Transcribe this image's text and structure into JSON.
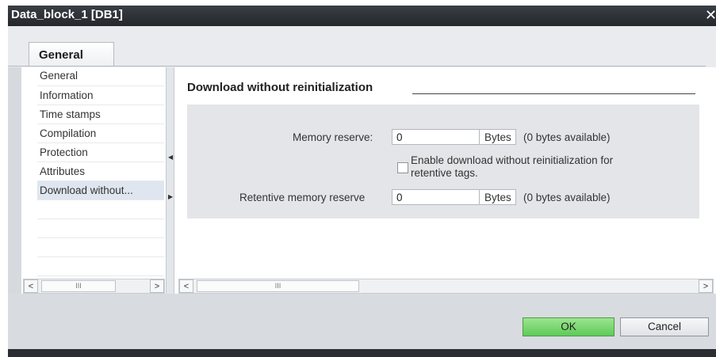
{
  "window": {
    "title": "Data_block_1 [DB1]",
    "close_glyph": "✕"
  },
  "tabs": [
    {
      "label": "General",
      "selected": true
    }
  ],
  "sidebar": {
    "items": [
      {
        "label": "General"
      },
      {
        "label": "Information"
      },
      {
        "label": "Time stamps"
      },
      {
        "label": "Compilation"
      },
      {
        "label": "Protection"
      },
      {
        "label": "Attributes"
      },
      {
        "label": "Download without...",
        "selected": true
      }
    ]
  },
  "scrollbar": {
    "left_arrow": "<",
    "right_arrow": ">",
    "thumb_grip": "III"
  },
  "section": {
    "title": "Download without reinitialization",
    "memory_reserve": {
      "label": "Memory reserve:",
      "value": "0",
      "unit": "Bytes",
      "available": "(0 bytes available)"
    },
    "enable_checkbox": {
      "label_line1": "Enable download without reinitialization for",
      "label_line2": "retentive tags.",
      "checked": false
    },
    "retentive_reserve": {
      "label": "Retentive memory reserve",
      "value": "0",
      "unit": "Bytes",
      "available": "(0 bytes available)"
    }
  },
  "buttons": {
    "ok": "OK",
    "cancel": "Cancel"
  },
  "colors": {
    "ok_button": "#5ecb58",
    "titlebar": "#24272c",
    "selected_item": "#dfe6ef"
  }
}
